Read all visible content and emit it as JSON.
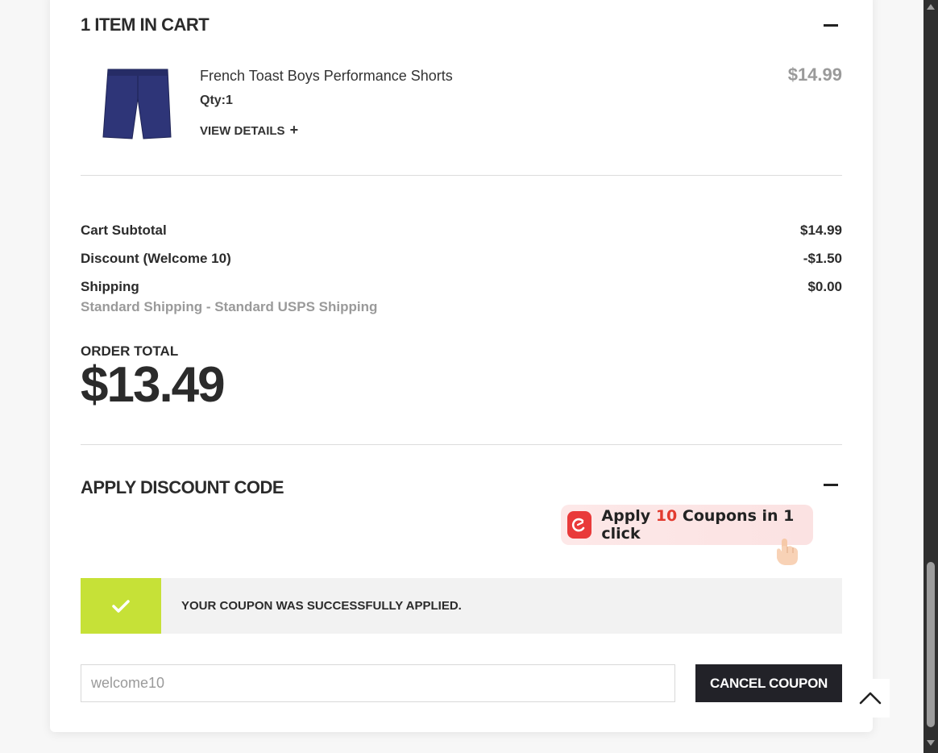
{
  "cart": {
    "title": "1 ITEM IN CART",
    "item": {
      "name": "French Toast Boys Performance Shorts",
      "qty": "Qty:1",
      "view_details": "VIEW DETAILS",
      "price": "$14.99",
      "image_icon": "navy-shorts-image"
    }
  },
  "summary": {
    "subtotal_label": "Cart Subtotal",
    "subtotal_value": "$14.99",
    "discount_label": "Discount (Welcome 10)",
    "discount_value": "-$1.50",
    "shipping_label": "Shipping",
    "shipping_value": "$0.00",
    "shipping_method": "Standard Shipping - Standard USPS Shipping",
    "order_total_label": "ORDER TOTAL",
    "order_total_value": "$13.49"
  },
  "discount": {
    "title": "APPLY DISCOUNT CODE",
    "popup": {
      "prefix": "Apply ",
      "count": "10",
      "suffix": " Coupons in 1 click"
    },
    "success_message": "YOUR COUPON WAS SUCCESSFULLY APPLIED.",
    "coupon_input_value": "welcome10",
    "cancel_label": "CANCEL COUPON"
  },
  "colors": {
    "success_green": "#c6e137",
    "coupon_red": "#e23b2f",
    "button_dark": "#222228",
    "price_grey": "#9a9a9a"
  }
}
